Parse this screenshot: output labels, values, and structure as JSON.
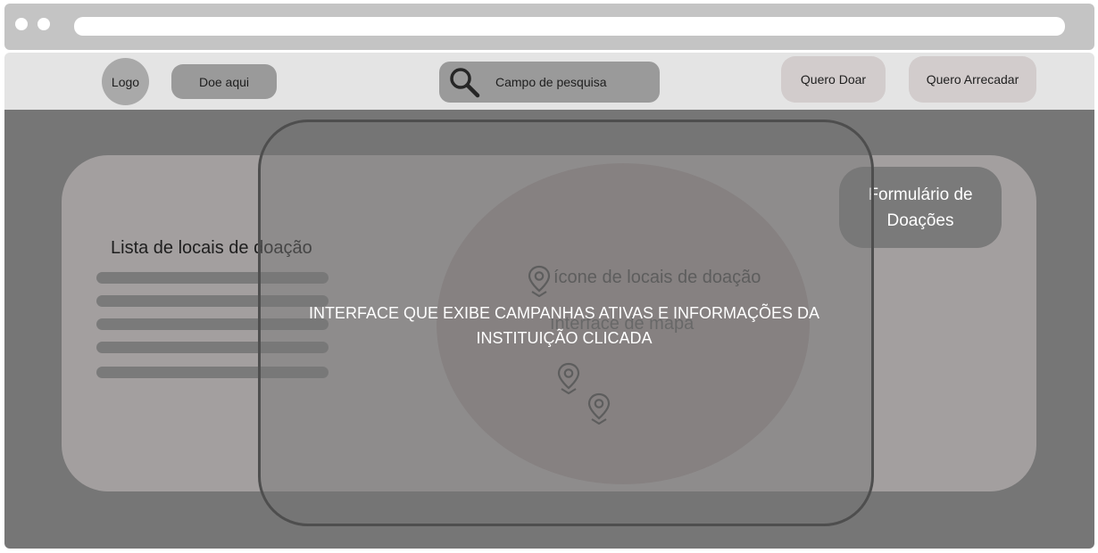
{
  "navbar": {
    "logo_label": "Logo",
    "donate_here_label": "Doe aqui",
    "search_placeholder": "Campo de pesquisa",
    "quero_doar_label": "Quero Doar",
    "quero_arrecadar_label": "Quero Arrecadar"
  },
  "list": {
    "title": "Lista de locais de doação"
  },
  "map": {
    "pin_legend": "ícone de locais de doação",
    "label": "Interface de mapa"
  },
  "form": {
    "label_line1": "Formulário de",
    "label_line2": "Doações"
  },
  "modal": {
    "text_line1": "INTERFACE QUE EXIBE CAMPANHAS ATIVAS E INFORMAÇÕES DA",
    "text_line2": "INSTITUIÇÃO CLICADA"
  },
  "icons": [
    "search-icon",
    "map-pin-icon"
  ]
}
